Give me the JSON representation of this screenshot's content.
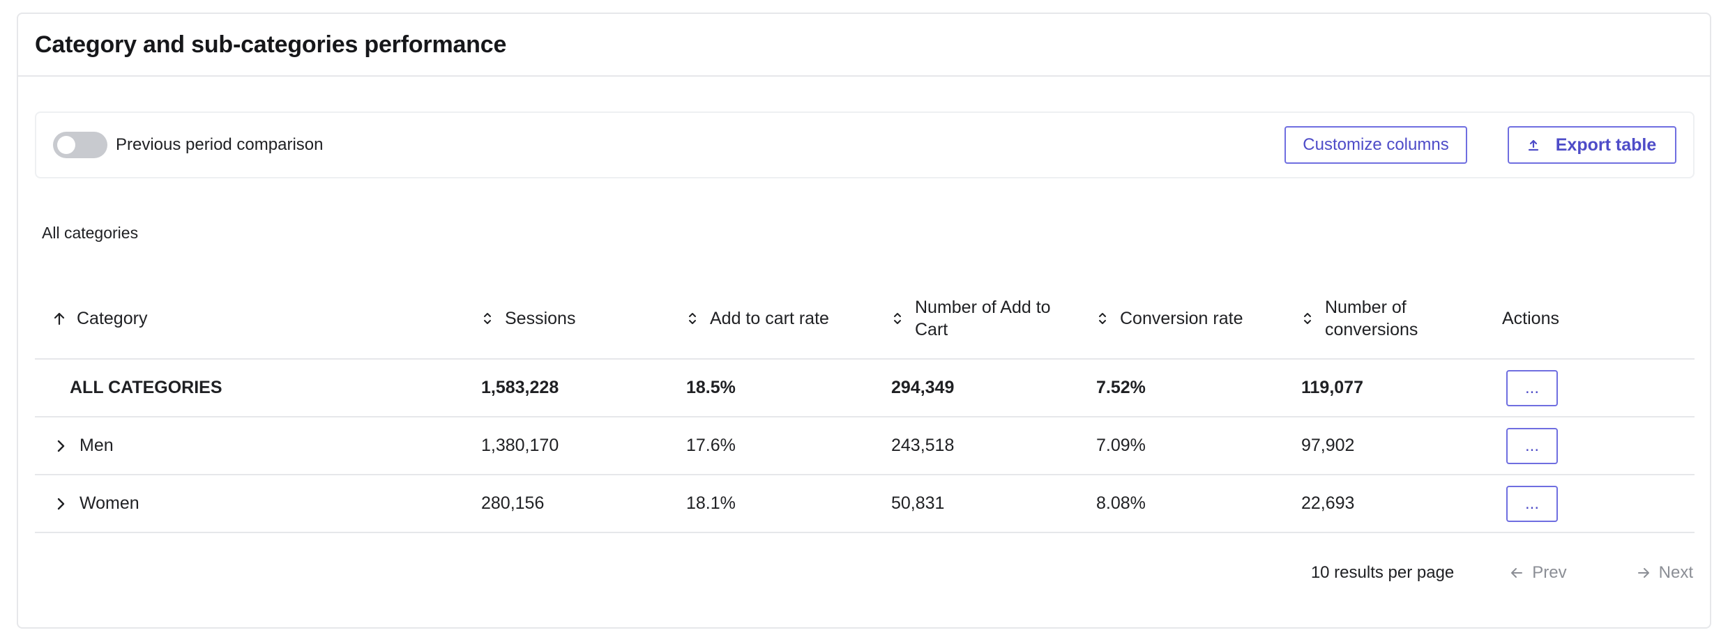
{
  "card": {
    "title": "Category and sub-categories performance"
  },
  "toolbar": {
    "toggle_label": "Previous period comparison",
    "toggle_on": false,
    "customize_label": "Customize columns",
    "export_label": "Export table"
  },
  "breadcrumb": "All categories",
  "table": {
    "columns": {
      "category": "Category",
      "sessions": "Sessions",
      "add_to_cart_rate": "Add to cart rate",
      "number_add_to_cart": "Number of Add to Cart",
      "conversion_rate": "Conversion rate",
      "number_conversions": "Number of conversions",
      "actions": "Actions"
    },
    "rows": [
      {
        "category": "ALL CATEGORIES",
        "sessions": "1,583,228",
        "add_to_cart_rate": "18.5%",
        "number_add_to_cart": "294,349",
        "conversion_rate": "7.52%",
        "number_conversions": "119,077",
        "action": "..."
      },
      {
        "category": "Men",
        "sessions": "1,380,170",
        "add_to_cart_rate": "17.6%",
        "number_add_to_cart": "243,518",
        "conversion_rate": "7.09%",
        "number_conversions": "97,902",
        "action": "..."
      },
      {
        "category": "Women",
        "sessions": "280,156",
        "add_to_cart_rate": "18.1%",
        "number_add_to_cart": "50,831",
        "conversion_rate": "8.08%",
        "number_conversions": "22,693",
        "action": "..."
      }
    ]
  },
  "pagination": {
    "per_page": "10 results per page",
    "prev": "Prev",
    "next": "Next"
  },
  "colors": {
    "accent": "#4e4cc8",
    "border": "#e6e7ea",
    "muted": "#8b8e95"
  }
}
